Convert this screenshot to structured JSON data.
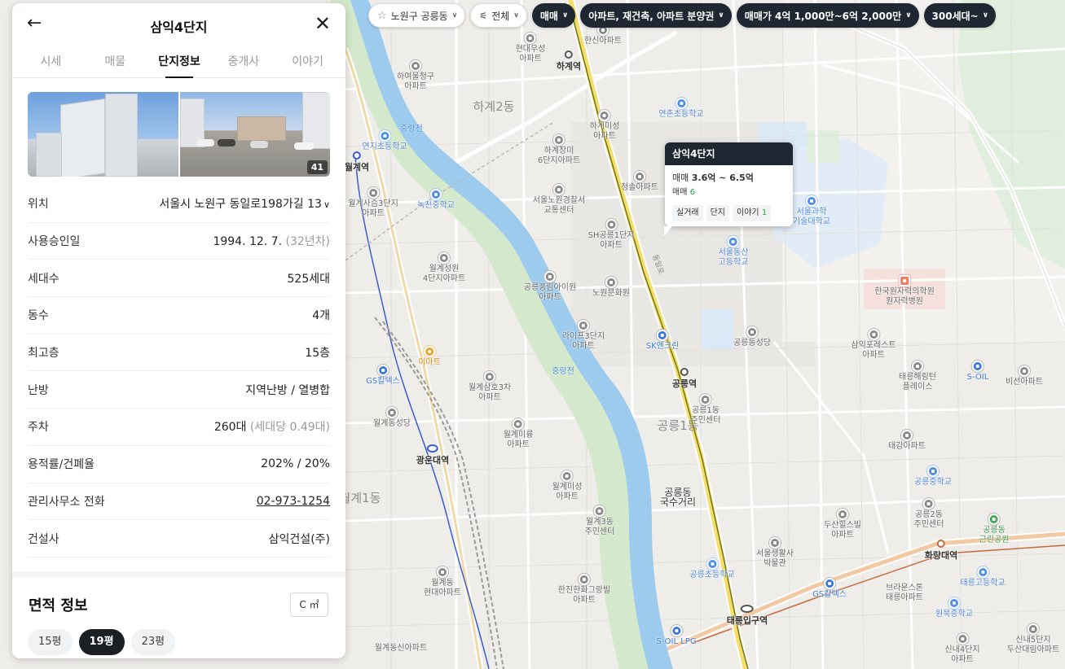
{
  "filters": {
    "region": "노원구 공릉동",
    "all": "전체",
    "trade": "매매",
    "types": "아파트, 재건축, 아파트 분양권",
    "price": "매매가 4억 1,000만~6억 2,000만",
    "households": "300세대~"
  },
  "panel": {
    "title": "삼익4단지",
    "tabs": [
      "시세",
      "매물",
      "단지정보",
      "중개사",
      "이야기"
    ],
    "photo_count": "41",
    "rows": [
      {
        "key": "위치",
        "value": "서울시 노원구 동일로198가길 13",
        "sub": ""
      },
      {
        "key": "사용승인일",
        "value": "1994. 12. 7.",
        "sub": "(32년차)"
      },
      {
        "key": "세대수",
        "value": "525세대",
        "sub": ""
      },
      {
        "key": "동수",
        "value": "4개",
        "sub": ""
      },
      {
        "key": "최고층",
        "value": "15층",
        "sub": ""
      },
      {
        "key": "난방",
        "value": "지역난방 / 열병합",
        "sub": ""
      },
      {
        "key": "주차",
        "value": "260대",
        "sub": "(세대당 0.49대)"
      },
      {
        "key": "용적률/건폐율",
        "value": "202% / 20%",
        "sub": ""
      },
      {
        "key": "관리사무소 전화",
        "value": "02-973-1254",
        "sub": ""
      },
      {
        "key": "건설사",
        "value": "삼익건설(주)",
        "sub": ""
      }
    ],
    "area_title": "면적 정보",
    "unit_toggle": "C ㎡",
    "pyeong_chips": [
      "15평",
      "19평",
      "23평"
    ],
    "selected_pyeong": "19평"
  },
  "popup": {
    "title": "삼익4단지",
    "price_label": "매매",
    "price_range": "3.6억 ~ 6.5억",
    "count_label": "매매",
    "count": "6",
    "buttons": {
      "deals": "실거래",
      "complex": "단지",
      "story": "이야기",
      "story_count": "1"
    }
  },
  "map": {
    "areas": [
      "하계2동",
      "공릉1동",
      "월계1동"
    ],
    "stations": [
      "하계역",
      "공릉역",
      "광운대역",
      "화랑대역",
      "태릉입구역",
      "월계역"
    ],
    "streams": [
      "중랑천",
      "중랑천"
    ],
    "roads": [
      "동일로"
    ],
    "pois": [
      {
        "name": "현대우성\n아파트",
        "type": "apt"
      },
      {
        "name": "한신아파트",
        "type": "apt"
      },
      {
        "name": "하여울청구\n아파트",
        "type": "apt"
      },
      {
        "name": "연촌초등학교",
        "type": "school"
      },
      {
        "name": "하계미성\n아파트",
        "type": "apt"
      },
      {
        "name": "하계장미\n6단지아파트",
        "type": "apt"
      },
      {
        "name": "연지초등학교",
        "type": "school"
      },
      {
        "name": "청솔아파트",
        "type": "apt"
      },
      {
        "name": "서울노원경찰서\n교통센터",
        "type": "apt"
      },
      {
        "name": "녹천중학교",
        "type": "school"
      },
      {
        "name": "월계사슴3단지\n아파트",
        "type": "apt"
      },
      {
        "name": "SH공릉1단지\n아파트",
        "type": "apt"
      },
      {
        "name": "서울과학\n기술대학교",
        "type": "school"
      },
      {
        "name": "서울동산\n고등학교",
        "type": "school"
      },
      {
        "name": "월계성원\n4단지아파트",
        "type": "apt"
      },
      {
        "name": "공릉풍림아이원\n아파트",
        "type": "apt"
      },
      {
        "name": "노원문화원",
        "type": "apt"
      },
      {
        "name": "한국원자력의학원\n원자력병원",
        "type": "hosp"
      },
      {
        "name": "라이프3단지\n아파트",
        "type": "apt"
      },
      {
        "name": "SK엔크린",
        "type": "gas"
      },
      {
        "name": "공릉동성당",
        "type": "apt"
      },
      {
        "name": "삼익포레스트\n아파트",
        "type": "apt"
      },
      {
        "name": "이마트",
        "type": "mart"
      },
      {
        "name": "GS칼텍스",
        "type": "gas"
      },
      {
        "name": "월계삼호3차\n아파트",
        "type": "apt"
      },
      {
        "name": "공릉1동\n주민센터",
        "type": "apt"
      },
      {
        "name": "태릉해링턴\n플레이스",
        "type": "apt"
      },
      {
        "name": "S-OIL",
        "type": "gas"
      },
      {
        "name": "비선아파트",
        "type": "apt"
      },
      {
        "name": "월계동성당",
        "type": "apt"
      },
      {
        "name": "월계미륭\n아파트",
        "type": "apt"
      },
      {
        "name": "태강아파트",
        "type": "apt"
      },
      {
        "name": "공릉중학교",
        "type": "school"
      },
      {
        "name": "월계미성\n아파트",
        "type": "apt"
      },
      {
        "name": "공릉동\n국수거리",
        "type": "apt"
      },
      {
        "name": "월계3동\n주민센터",
        "type": "apt"
      },
      {
        "name": "공릉2동\n주민센터",
        "type": "apt"
      },
      {
        "name": "두산힐스빌\n아파트",
        "type": "apt"
      },
      {
        "name": "공릉동\n근린공원",
        "type": "park"
      },
      {
        "name": "서울생활사\n박물관",
        "type": "apt"
      },
      {
        "name": "공릉초등학교",
        "type": "school"
      },
      {
        "name": "GS칼텍스",
        "type": "gas"
      },
      {
        "name": "브라운스톤\n태릉아파트",
        "type": "apt"
      },
      {
        "name": "태릉고등학교",
        "type": "school"
      },
      {
        "name": "월계동\n현대아파트",
        "type": "apt"
      },
      {
        "name": "한진한화그랑빌\n아파트",
        "type": "apt"
      },
      {
        "name": "원묵중학교",
        "type": "school"
      },
      {
        "name": "S-OIL LPG",
        "type": "gas"
      },
      {
        "name": "월계동신아파트",
        "type": "apt"
      },
      {
        "name": "신내4단지\n아파트",
        "type": "apt"
      },
      {
        "name": "신내5단지\n두산대림아파트",
        "type": "apt"
      }
    ]
  }
}
